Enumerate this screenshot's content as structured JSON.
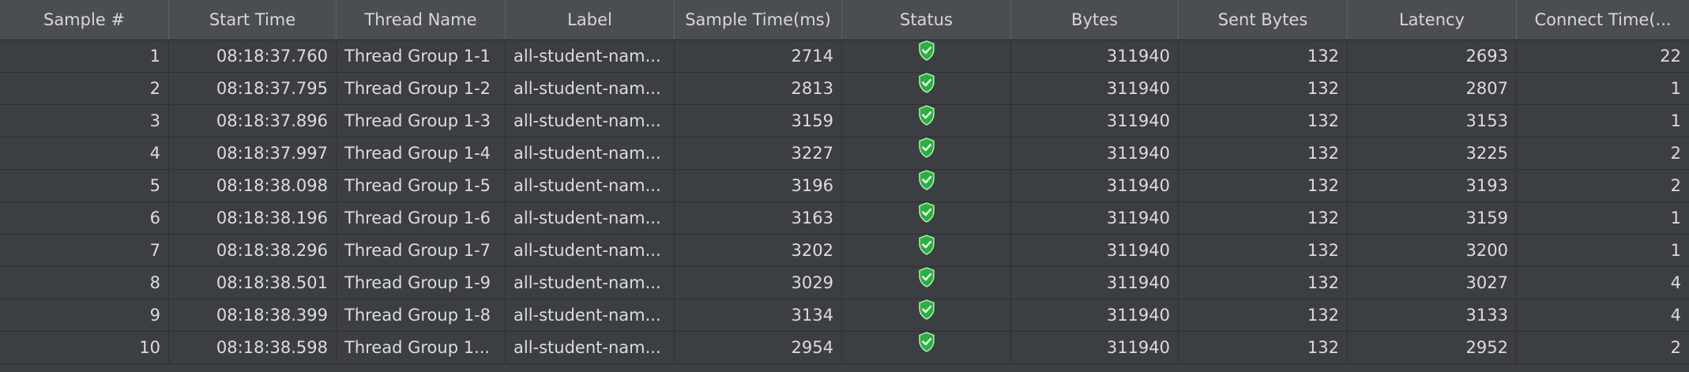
{
  "columns": [
    "Sample #",
    "Start Time",
    "Thread Name",
    "Label",
    "Sample Time(ms)",
    "Status",
    "Bytes",
    "Sent Bytes",
    "Latency",
    "Connect Time(..."
  ],
  "status_icon": "green-shield-check-icon",
  "colors": {
    "success": "#27b23a",
    "background": "#3c3f41",
    "header": "#4b4e50"
  },
  "rows": [
    {
      "sample": "1",
      "start": "08:18:37.760",
      "thread": "Thread Group 1-1",
      "label": "all-student-nam...",
      "time": "2714",
      "bytes": "311940",
      "sent": "132",
      "latency": "2693",
      "connect": "22"
    },
    {
      "sample": "2",
      "start": "08:18:37.795",
      "thread": "Thread Group 1-2",
      "label": "all-student-nam...",
      "time": "2813",
      "bytes": "311940",
      "sent": "132",
      "latency": "2807",
      "connect": "1"
    },
    {
      "sample": "3",
      "start": "08:18:37.896",
      "thread": "Thread Group 1-3",
      "label": "all-student-nam...",
      "time": "3159",
      "bytes": "311940",
      "sent": "132",
      "latency": "3153",
      "connect": "1"
    },
    {
      "sample": "4",
      "start": "08:18:37.997",
      "thread": "Thread Group 1-4",
      "label": "all-student-nam...",
      "time": "3227",
      "bytes": "311940",
      "sent": "132",
      "latency": "3225",
      "connect": "2"
    },
    {
      "sample": "5",
      "start": "08:18:38.098",
      "thread": "Thread Group 1-5",
      "label": "all-student-nam...",
      "time": "3196",
      "bytes": "311940",
      "sent": "132",
      "latency": "3193",
      "connect": "2"
    },
    {
      "sample": "6",
      "start": "08:18:38.196",
      "thread": "Thread Group 1-6",
      "label": "all-student-nam...",
      "time": "3163",
      "bytes": "311940",
      "sent": "132",
      "latency": "3159",
      "connect": "1"
    },
    {
      "sample": "7",
      "start": "08:18:38.296",
      "thread": "Thread Group 1-7",
      "label": "all-student-nam...",
      "time": "3202",
      "bytes": "311940",
      "sent": "132",
      "latency": "3200",
      "connect": "1"
    },
    {
      "sample": "8",
      "start": "08:18:38.501",
      "thread": "Thread Group 1-9",
      "label": "all-student-nam...",
      "time": "3029",
      "bytes": "311940",
      "sent": "132",
      "latency": "3027",
      "connect": "4"
    },
    {
      "sample": "9",
      "start": "08:18:38.399",
      "thread": "Thread Group 1-8",
      "label": "all-student-nam...",
      "time": "3134",
      "bytes": "311940",
      "sent": "132",
      "latency": "3133",
      "connect": "4"
    },
    {
      "sample": "10",
      "start": "08:18:38.598",
      "thread": "Thread Group 1...",
      "label": "all-student-nam...",
      "time": "2954",
      "bytes": "311940",
      "sent": "132",
      "latency": "2952",
      "connect": "2"
    }
  ]
}
